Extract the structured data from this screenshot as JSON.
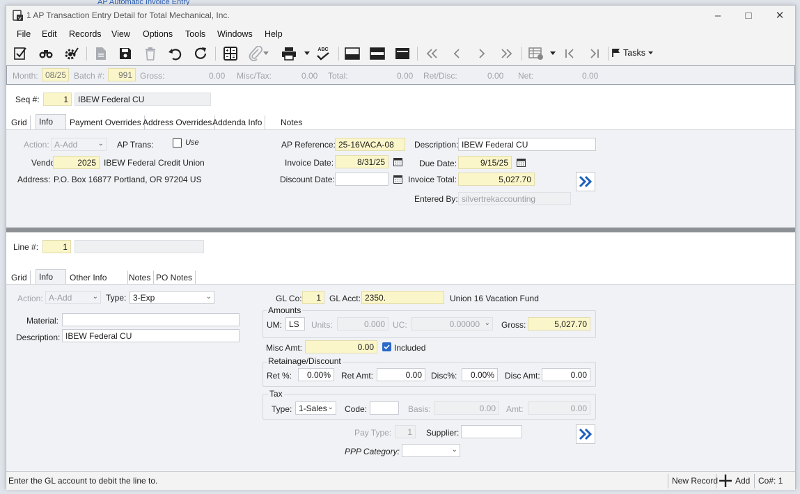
{
  "background_window": {
    "title": "AP Automatic Invoice Entry"
  },
  "window": {
    "title": "1 AP Transaction Entry Detail for Total Mechanical, Inc."
  },
  "menu": [
    "File",
    "Edit",
    "Records",
    "View",
    "Options",
    "Tools",
    "Windows",
    "Help"
  ],
  "toolbar": {
    "tasks_label": "Tasks",
    "spell_label": "ABC"
  },
  "batch": {
    "month_label": "Month:",
    "month": "08/25",
    "batch_label": "Batch #:",
    "batch_no": "991",
    "gross_label": "Gross:",
    "gross": "0.00",
    "misc_label": "Misc/Tax:",
    "misc": "0.00",
    "total_label": "Total:",
    "total": "0.00",
    "retdisc_label": "Ret/Disc:",
    "retdisc": "0.00",
    "net_label": "Net:",
    "net": "0.00"
  },
  "header": {
    "seq_label": "Seq #:",
    "seq": "1",
    "seq_desc": "IBEW Federal CU",
    "tabs": [
      "Grid",
      "Info",
      "Payment Overrides",
      "Address Overrides",
      "Addenda Info",
      "Notes"
    ],
    "action_label": "Action:",
    "action": "A-Add",
    "ap_trans_label": "AP Trans:",
    "use_label": "Use",
    "vendor_label": "Vendor:",
    "vendor": "2025",
    "vendor_name": "IBEW Federal Credit Union",
    "address_label": "Address:",
    "address": "P.O. Box 16877  Portland, OR  97204  US",
    "ap_ref_label": "AP Reference:",
    "ap_ref": "25-16VACA-08",
    "description_label": "Description:",
    "description": "IBEW Federal CU",
    "invoice_date_label": "Invoice Date:",
    "invoice_date": "8/31/25",
    "due_date_label": "Due Date:",
    "due_date": "9/15/25",
    "discount_date_label": "Discount Date:",
    "discount_date": "",
    "invoice_total_label": "Invoice Total:",
    "invoice_total": "5,027.70",
    "entered_by_label": "Entered By:",
    "entered_by": "silvertrekaccounting"
  },
  "line": {
    "line_label": "Line #:",
    "line_no": "1",
    "tabs": [
      "Grid",
      "Info",
      "Other Info",
      "Notes",
      "PO Notes"
    ],
    "action_label": "Action:",
    "action": "A-Add",
    "type_label": "Type:",
    "type": "3-Exp",
    "material_label": "Material:",
    "material": "",
    "description_label": "Description:",
    "description": "IBEW Federal CU",
    "glco_label": "GL Co:",
    "glco": "1",
    "glacct_label": "GL Acct:",
    "glacct": "2350.",
    "glacct_desc": "Union 16 Vacation Fund",
    "amounts_title": "Amounts",
    "um_label": "UM:",
    "um": "LS",
    "units_label": "Units:",
    "units": "0.000",
    "uc_label": "UC:",
    "uc": "0.00000",
    "gross_label": "Gross:",
    "gross": "5,027.70",
    "misc_label": "Misc Amt:",
    "misc": "0.00",
    "included_label": "Included",
    "retdisc_title": "Retainage/Discount",
    "retpct_label": "Ret %:",
    "retpct": "0.00%",
    "retamt_label": "Ret Amt:",
    "retamt": "0.00",
    "discpct_label": "Disc%:",
    "discpct": "0.00%",
    "discamt_label": "Disc Amt:",
    "discamt": "0.00",
    "tax_title": "Tax",
    "taxtype_label": "Type:",
    "taxtype": "1-Sales",
    "code_label": "Code:",
    "code": "",
    "basis_label": "Basis:",
    "basis": "0.00",
    "amt_label": "Amt:",
    "amt": "0.00",
    "paytype_label": "Pay Type:",
    "paytype": "1",
    "supplier_label": "Supplier:",
    "supplier": "",
    "ppp_label": "PPP Category:",
    "ppp": ""
  },
  "status": {
    "message": "Enter the GL account to debit the line to.",
    "new_record": "New Record",
    "add": "Add",
    "co": "Co#: 1"
  }
}
